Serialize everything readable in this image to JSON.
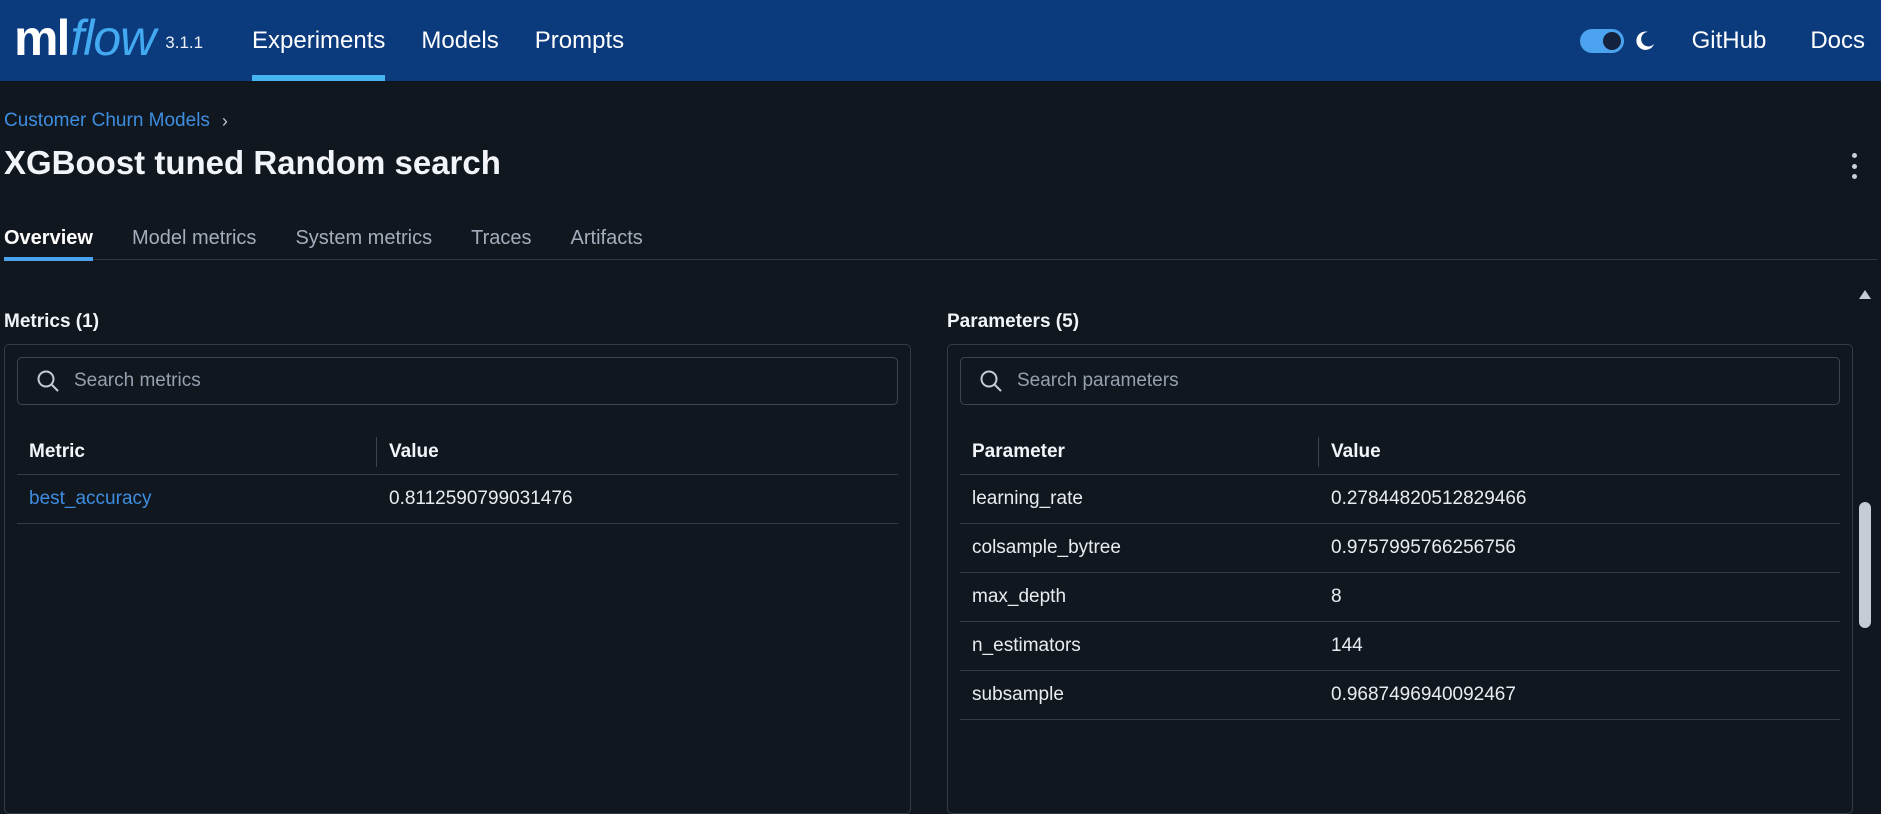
{
  "app": {
    "logo_ml": "ml",
    "logo_flow": "flow",
    "version": "3.1.1"
  },
  "nav": {
    "items": [
      {
        "label": "Experiments",
        "active": true
      },
      {
        "label": "Models",
        "active": false
      },
      {
        "label": "Prompts",
        "active": false
      }
    ],
    "github": "GitHub",
    "docs": "Docs",
    "theme_toggle_on": true
  },
  "header": {
    "breadcrumb": "Customer Churn Models",
    "breadcrumb_separator": "›",
    "title": "XGBoost tuned Random search"
  },
  "tabs": [
    {
      "label": "Overview",
      "active": true
    },
    {
      "label": "Model metrics",
      "active": false
    },
    {
      "label": "System metrics",
      "active": false
    },
    {
      "label": "Traces",
      "active": false
    },
    {
      "label": "Artifacts",
      "active": false
    }
  ],
  "metrics": {
    "title": "Metrics (1)",
    "search_placeholder": "Search metrics",
    "columns": [
      "Metric",
      "Value"
    ],
    "rows": [
      {
        "name": "best_accuracy",
        "value": "0.8112590799031476"
      }
    ]
  },
  "parameters": {
    "title": "Parameters (5)",
    "search_placeholder": "Search parameters",
    "columns": [
      "Parameter",
      "Value"
    ],
    "rows": [
      {
        "name": "learning_rate",
        "value": "0.27844820512829466"
      },
      {
        "name": "colsample_bytree",
        "value": "0.9757995766256756"
      },
      {
        "name": "max_depth",
        "value": "8"
      },
      {
        "name": "n_estimators",
        "value": "144"
      },
      {
        "name": "subsample",
        "value": "0.9687496940092467"
      }
    ]
  },
  "colors": {
    "topbar": "#0b3a7d",
    "accent": "#4ba3f0",
    "link": "#3d8ee0",
    "background": "#11171f"
  }
}
